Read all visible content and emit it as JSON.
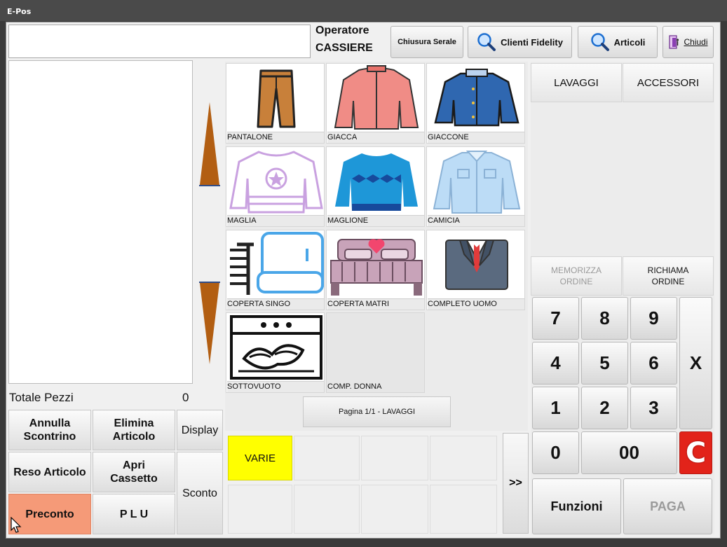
{
  "window": {
    "title": "E-Pos"
  },
  "header": {
    "search_value": "",
    "operator_label": "Operatore",
    "operator_value": "CASSIERE",
    "buttons": {
      "chiusura": "Chiusura Serale",
      "clienti": "Clienti Fidelity",
      "articoli": "Articoli",
      "chiudi": "Chiudi"
    }
  },
  "receipt": {
    "totale_label": "Totale Pezzi",
    "totale_value": "0"
  },
  "left_buttons": {
    "annulla": "Annulla Scontrino",
    "elimina": "Elimina Articolo",
    "display": "Display",
    "reso": "Reso Articolo",
    "apri": "Apri Cassetto",
    "sconto": "Sconto",
    "preconto": "Preconto",
    "plu": "P L U"
  },
  "items": [
    {
      "label": "PANTALONE",
      "icon": "pants-icon"
    },
    {
      "label": "GIACCA",
      "icon": "jacket-icon"
    },
    {
      "label": "GIACCONE",
      "icon": "coat-icon"
    },
    {
      "label": "MAGLIA",
      "icon": "shirt-star-icon"
    },
    {
      "label": "MAGLIONE",
      "icon": "sweater-icon"
    },
    {
      "label": "CAMICIA",
      "icon": "dress-shirt-icon"
    },
    {
      "label": "COPERTA SINGO",
      "icon": "blanket-icon"
    },
    {
      "label": "COPERTA MATRI",
      "icon": "double-bed-icon"
    },
    {
      "label": "COMPLETO UOMO",
      "icon": "suit-icon"
    },
    {
      "label": "SOTTOVUOTO",
      "icon": "vacuum-bag-icon"
    },
    {
      "label": "COMP. DONNA",
      "icon": ""
    }
  ],
  "pagination": "Pagina 1/1 - LAVAGGI",
  "quick": {
    "varie": "VARIE",
    "more": ">>"
  },
  "categories": {
    "lavaggi": "LAVAGGI",
    "accessori": "ACCESSORI"
  },
  "order": {
    "memorizza": "MEMORIZZA ORDINE",
    "richiama": "RICHIAMA ORDINE"
  },
  "keypad": {
    "k7": "7",
    "k8": "8",
    "k9": "9",
    "k4": "4",
    "k5": "5",
    "k6": "6",
    "k1": "1",
    "k2": "2",
    "k3": "3",
    "k0": "0",
    "k00": "00",
    "x": "X",
    "c": "C",
    "funzioni": "Funzioni",
    "paga": "PAGA"
  },
  "colors": {
    "varie_bg": "#ffff00",
    "preconto_bg": "#f59a78",
    "clear_bg": "#e2231a",
    "arrow": "#b25e12"
  }
}
